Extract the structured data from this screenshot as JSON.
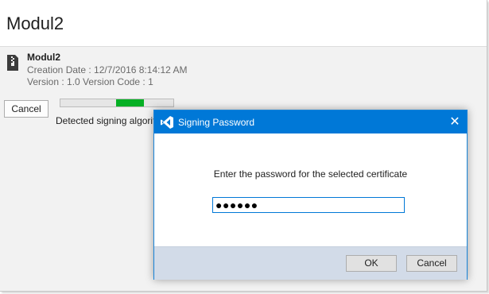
{
  "window": {
    "title": "Modul2"
  },
  "item": {
    "name": "Modul2",
    "creation_date": "Creation Date :  12/7/2016 8:14:12 AM",
    "version_line": "Version :  1.0    Version Code :  1"
  },
  "actions": {
    "cancel_label": "Cancel"
  },
  "progress": {
    "start_fraction": 0.49,
    "end_fraction": 0.74,
    "color": "#06b025"
  },
  "status": {
    "text": "Detected signing algorithm"
  },
  "dialog": {
    "title": "Signing Password",
    "close_glyph": "✕",
    "prompt": "Enter the password for the selected certificate",
    "password_mask": "●●●●●●",
    "ok_label": "OK",
    "cancel_label": "Cancel",
    "accent": "#0078d7"
  },
  "icons": [
    "archive-icon",
    "visual-studio-icon",
    "close-icon"
  ]
}
